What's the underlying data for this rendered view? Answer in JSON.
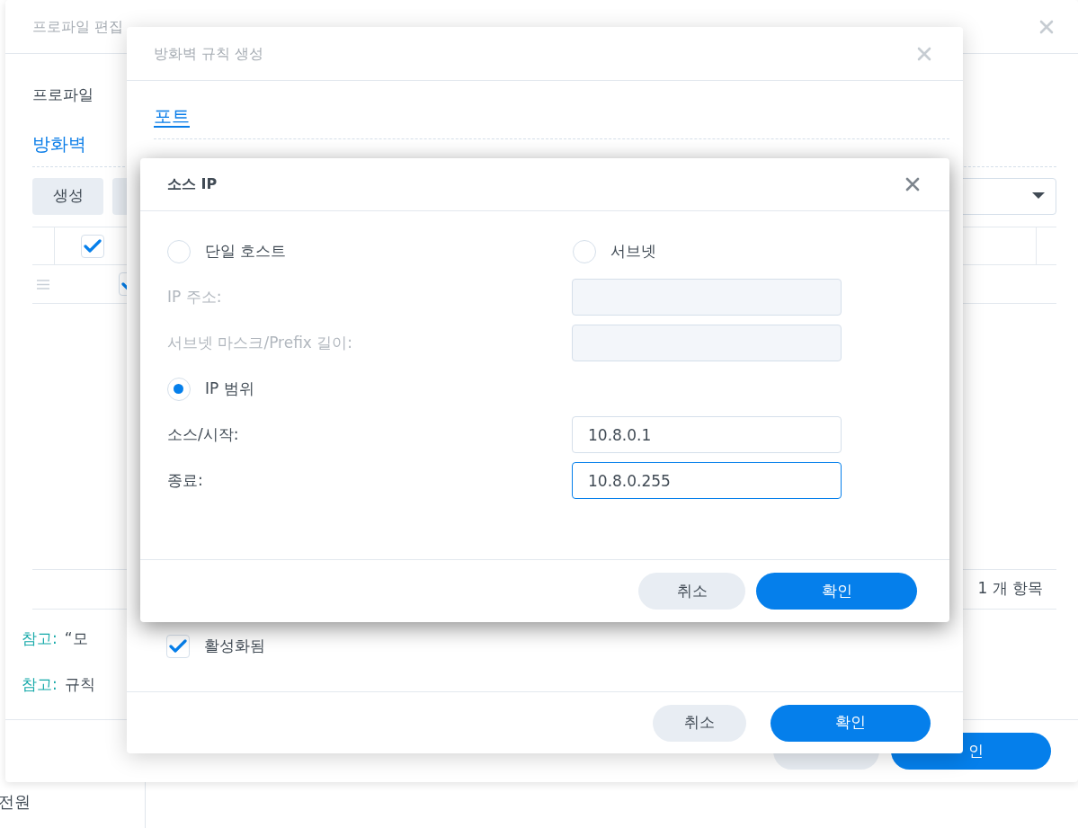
{
  "sidebar": {
    "items": [
      {
        "label": "전원"
      }
    ]
  },
  "profile_window": {
    "title": "프로파일 편집",
    "profile_label": "프로파일",
    "section_title": "방화벽",
    "create_button": "생성",
    "header_checkbox_checked": true,
    "row_checkbox_checked": true,
    "item_count": "1 개 항목",
    "notes": [
      {
        "label": "참고:",
        "text": "“모"
      },
      {
        "label": "참고:",
        "text": "규칙"
      }
    ],
    "confirm_button": "인"
  },
  "rule_window": {
    "title": "방화벽 규칙 생성",
    "port_link": "포트",
    "enabled": {
      "label": "활성화됨",
      "checked": true
    },
    "buttons": [
      {
        "label": "취소",
        "kind": "secondary"
      },
      {
        "label": "확인",
        "kind": "primary"
      }
    ]
  },
  "source_ip_dialog": {
    "title": "소스 IP",
    "options": [
      {
        "label": "단일 호스트",
        "selected": false
      },
      {
        "label": "서브넷",
        "selected": false
      },
      {
        "label": "IP 범위",
        "selected": true
      }
    ],
    "fields": [
      {
        "label": "IP 주소:",
        "disabled": true,
        "focused": false
      },
      {
        "label": "서브넷 마스크/Prefix 길이:",
        "disabled": true,
        "focused": false
      },
      {
        "label": "소스/시작:",
        "value": "10.8.0.1",
        "disabled": false,
        "focused": false
      },
      {
        "label": "종료:",
        "value": "10.8.0.255",
        "disabled": false,
        "focused": true
      }
    ],
    "buttons": [
      {
        "label": "취소",
        "kind": "secondary"
      },
      {
        "label": "확인",
        "kind": "primary"
      }
    ]
  }
}
